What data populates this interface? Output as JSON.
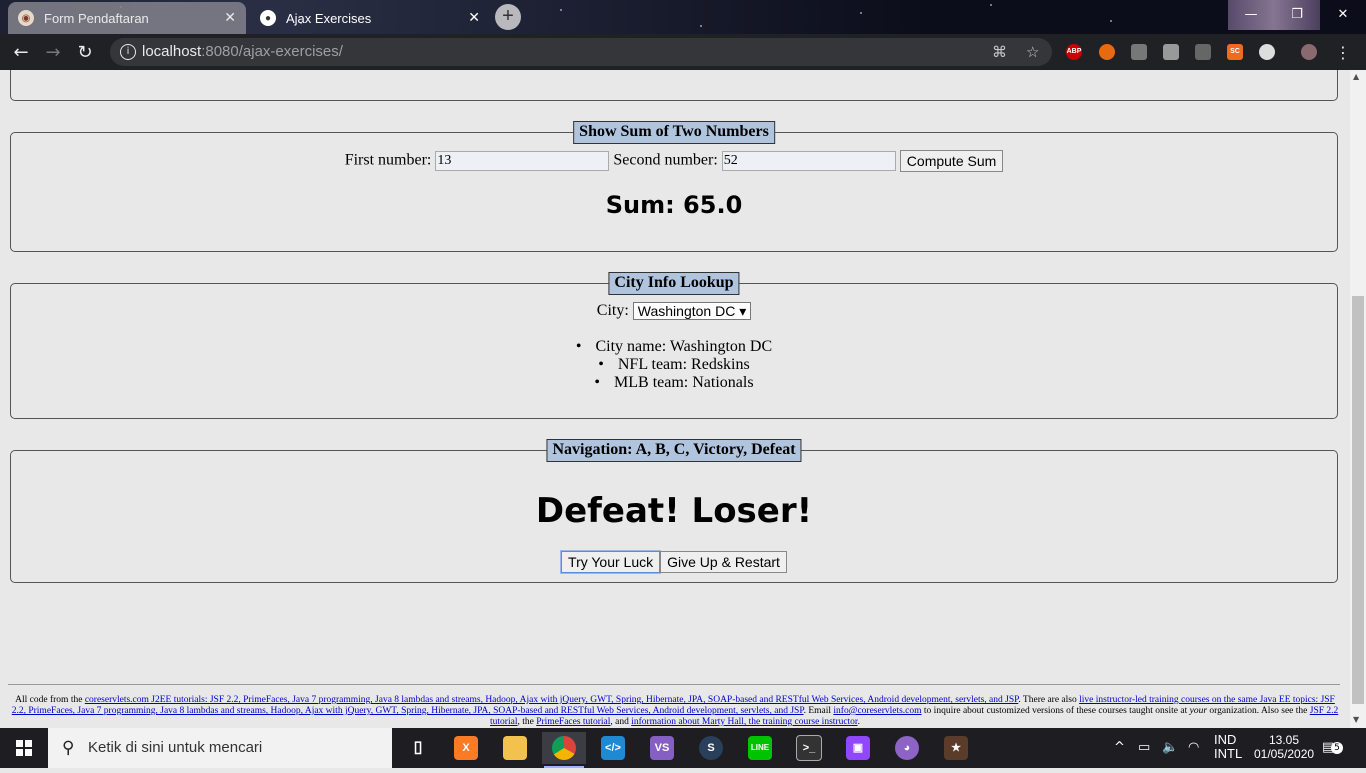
{
  "browser": {
    "tabs": [
      {
        "title": "Form Pendaftaran",
        "active": false
      },
      {
        "title": "Ajax Exercises",
        "active": true
      }
    ],
    "new_tab_label": "+",
    "window_controls": {
      "minimize": "—",
      "maximize": "❐",
      "close": "✕"
    },
    "address": {
      "host": "localhost",
      "rest": ":8080/ajax-exercises/"
    },
    "extensions": [
      "ABP",
      "SC"
    ]
  },
  "sum_section": {
    "legend": "Show Sum of Two Numbers",
    "first_label": "First number:",
    "first_value": "13",
    "second_label": "Second number:",
    "second_value": "52",
    "button": "Compute Sum",
    "result": "Sum: 65.0"
  },
  "city_section": {
    "legend": "City Info Lookup",
    "city_label": "City:",
    "selected_city": "Washington DC",
    "items": [
      "City name: Washington DC",
      "NFL team: Redskins",
      "MLB team: Nationals"
    ]
  },
  "nav_section": {
    "legend": "Navigation: A, B, C, Victory, Defeat",
    "message": "Defeat! Loser!",
    "buttons": {
      "try": "Try Your Luck",
      "restart": "Give Up & Restart"
    }
  },
  "footer": {
    "t1": "All code from the ",
    "l1": "coreservlets.com J2EE tutorials: JSF 2.2, PrimeFaces, Java 7 programming, Java 8 lambdas and streams, Hadoop, Ajax with jQuery, GWT, Spring, Hibernate, JPA, SOAP-based and RESTful Web Services, Android development, servlets, and JSP",
    "t2": ". There are also ",
    "l2": "live instructor-led training courses on the same Java EE topics: JSF 2.2, PrimeFaces, Java 7 programming, Java 8 lambdas and streams, Hadoop, Ajax with jQuery, GWT, Spring, Hibernate, JPA, SOAP-based and RESTful Web Services, Android development, servlets, and JSP",
    "t3": ". Email ",
    "l3": "info@coreservlets.com",
    "t4": " to inquire about customized versions of these courses taught onsite at ",
    "t4b": "your",
    "t4c": " organization. Also see the ",
    "l4": "JSF 2.2 tutorial",
    "t5": ", the ",
    "l5": "PrimeFaces tutorial",
    "t6": ", and ",
    "l6": "information about Marty Hall, the training course instructor",
    "t7": "."
  },
  "taskbar": {
    "search_placeholder": "Ketik di sini untuk mencari",
    "apps": [
      "task-view",
      "xampp",
      "file-explorer",
      "chrome",
      "vscode",
      "visual-studio",
      "steam",
      "line",
      "terminal",
      "twitch",
      "github-desktop",
      "game"
    ],
    "lang": "IND",
    "layout": "INTL",
    "time": "13.05",
    "date": "01/05/2020",
    "notifications": "5"
  },
  "colors": {
    "legend_bg": "#b0c4de",
    "page_bg": "#e8e8e8",
    "link": "#0000cc"
  }
}
